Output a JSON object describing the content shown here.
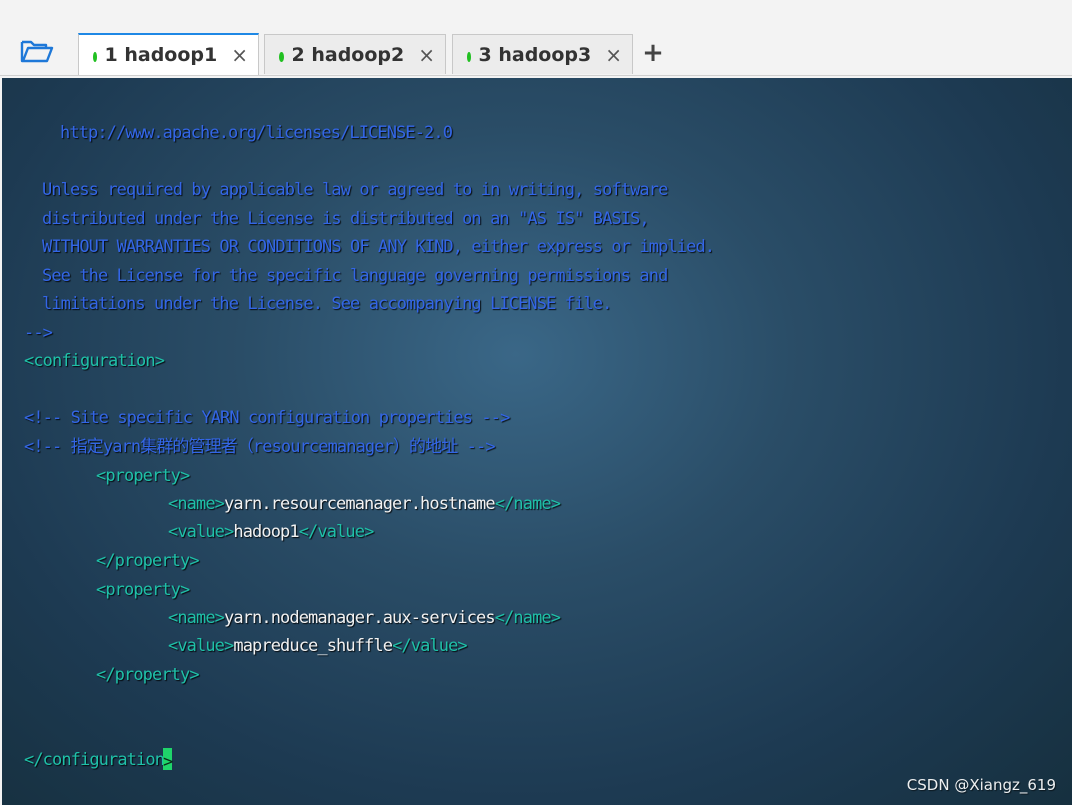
{
  "tabs": [
    {
      "label": "1 hadoop1",
      "close": "×",
      "status_color": "#22c022",
      "active": true
    },
    {
      "label": "2 hadoop2",
      "close": "×",
      "status_color": "#22c022",
      "active": false
    },
    {
      "label": "3 hadoop3",
      "close": "×",
      "status_color": "#22c022",
      "active": false
    }
  ],
  "add_tab": "+",
  "colors": {
    "comment": "#3366e6",
    "tag": "#1fc0a8",
    "text": "#f2f2f2",
    "cursor": "#1fd46a"
  },
  "terminal": {
    "l1": "http://www.apache.org/licenses/LICENSE-2.0",
    "l2": "Unless required by applicable law or agreed to in writing, software",
    "l3": "distributed under the License is distributed on an \"AS IS\" BASIS,",
    "l4": "WITHOUT WARRANTIES OR CONDITIONS OF ANY KIND, either express or implied.",
    "l5": "See the License for the specific language governing permissions and",
    "l6": "limitations under the License. See accompanying LICENSE file.",
    "l7": "-->",
    "l8": "<configuration>",
    "l9": "<!-- Site specific YARN configuration properties -->",
    "l10": "<!-- 指定yarn集群的管理者（resourcemanager）的地址 -->",
    "prop_open": "<property>",
    "prop_close": "</property>",
    "name_open": "<name>",
    "name_close": "</name>",
    "value_open": "<value>",
    "value_close": "</value>",
    "p1_name": "yarn.resourcemanager.hostname",
    "p1_value": "hadoop1",
    "p2_name": "yarn.nodemanager.aux-services",
    "p2_value": "mapreduce_shuffle",
    "end_body": "</configuration",
    "end_char": ">"
  },
  "watermark": "CSDN @Xiangz_619"
}
